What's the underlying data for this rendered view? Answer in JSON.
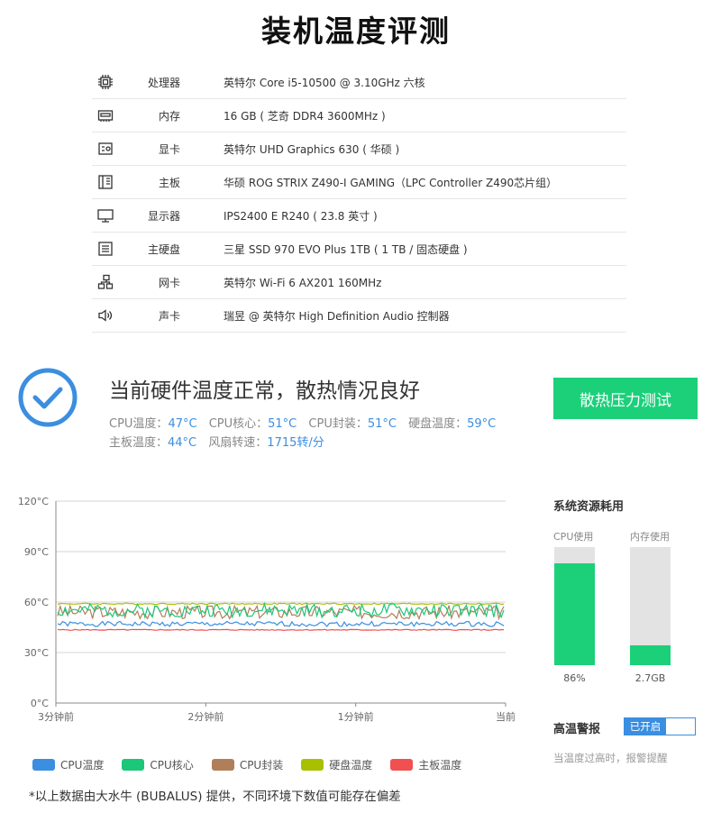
{
  "title": "装机温度评测",
  "specs": [
    {
      "icon": "cpu-icon",
      "label": "处理器",
      "value": "英特尔 Core i5-10500 @ 3.10GHz 六核"
    },
    {
      "icon": "memory-icon",
      "label": "内存",
      "value": "16 GB ( 芝奇 DDR4 3600MHz )"
    },
    {
      "icon": "gpu-icon",
      "label": "显卡",
      "value": "英特尔 UHD Graphics 630 ( 华硕 )"
    },
    {
      "icon": "motherboard-icon",
      "label": "主板",
      "value": "华硕 ROG STRIX Z490-I GAMING（LPC Controller Z490芯片组）"
    },
    {
      "icon": "monitor-icon",
      "label": "显示器",
      "value": "IPS2400 E R240 ( 23.8 英寸 )"
    },
    {
      "icon": "disk-icon",
      "label": "主硬盘",
      "value": "三星 SSD 970 EVO Plus 1TB ( 1 TB / 固态硬盘 )"
    },
    {
      "icon": "network-icon",
      "label": "网卡",
      "value": "英特尔 Wi-Fi 6 AX201 160MHz"
    },
    {
      "icon": "speaker-icon",
      "label": "声卡",
      "value": "瑞昱 @ 英特尔 High Definition Audio 控制器"
    }
  ],
  "status": {
    "title": "当前硬件温度正常，散热情况良好",
    "readings_row1": [
      {
        "label": "CPU温度：",
        "value": "47°C"
      },
      {
        "label": "CPU核心：",
        "value": "51°C"
      },
      {
        "label": "CPU封装：",
        "value": "51°C"
      },
      {
        "label": "硬盘温度：",
        "value": "59°C"
      }
    ],
    "readings_row2": [
      {
        "label": "主板温度：",
        "value": "44°C"
      },
      {
        "label": "风扇转速：",
        "value": "1715转/分"
      }
    ],
    "stress_button": "散热压力测试",
    "colors": {
      "check": "#3b8ee0",
      "button": "#1cd07a",
      "value": "#3b8ee0"
    }
  },
  "chart_data": {
    "type": "line",
    "x": [
      "3分钟前",
      "2分钟前",
      "1分钟前",
      "当前"
    ],
    "y_ticks": [
      "120°C",
      "90°C",
      "60°C",
      "30°C",
      "0°C"
    ],
    "ylim": [
      0,
      120
    ],
    "grid": true,
    "legend_position": "bottom",
    "series": [
      {
        "name": "CPU温度",
        "color": "#3b8ee0",
        "base": 47,
        "amp": 1.5,
        "seed": 1
      },
      {
        "name": "CPU核心",
        "color": "#1cc77a",
        "base": 55,
        "amp": 4,
        "seed": 2
      },
      {
        "name": "CPU封装",
        "color": "#b07f5a",
        "base": 54,
        "amp": 4,
        "seed": 3
      },
      {
        "name": "硬盘温度",
        "color": "#a8c000",
        "base": 59,
        "amp": 0.4,
        "seed": 4
      },
      {
        "name": "主板温度",
        "color": "#f05050",
        "base": 43.5,
        "amp": 0.3,
        "seed": 5
      }
    ]
  },
  "footnote": "*以上数据由大水牛 (BUBALUS) 提供，不同环境下数值可能存在偏差",
  "resources": {
    "title": "系统资源耗用",
    "cpu": {
      "label": "CPU使用",
      "percent": 86,
      "value": "86%"
    },
    "memory": {
      "label": "内存使用",
      "percent": 17,
      "value": "2.7GB"
    }
  },
  "alert": {
    "label": "高温警报",
    "toggle": "已开启",
    "note": "当温度过高时，报警提醒"
  }
}
